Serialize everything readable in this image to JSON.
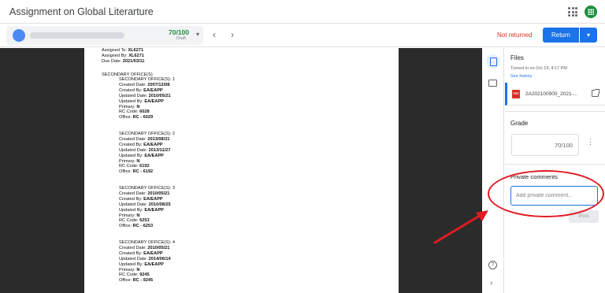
{
  "app": {
    "title": "Assignment on Global Literarture",
    "apps_icon": "apps-grid-icon",
    "logo_icon": "classroom-logo-icon"
  },
  "toolbar": {
    "student_grade": "70/100",
    "student_state": "Draft",
    "caret": "▾",
    "prev": "‹",
    "next": "›",
    "status": "Not returned",
    "return_label": "Return",
    "return_caret": "▾"
  },
  "document": {
    "header": [
      {
        "label": "Assigned To: ",
        "value": "XL6271"
      },
      {
        "label": "Assigned By: ",
        "value": "XL6271"
      },
      {
        "label": "Due Date: ",
        "value": "2021/03/11"
      }
    ],
    "section_title": "SECONDARY OFFICE(S)",
    "offices": [
      {
        "title": "SECONDARY OFFICE(S): 1",
        "created_date": "2007/12/08",
        "created_by": "EA/EAPP",
        "updated_date": "2010/05/21",
        "updated_by": "EA/EAPP",
        "primary": "N",
        "rc_code": "6028",
        "office": "RC - 6029"
      },
      {
        "title": "SECONDARY OFFICE(S): 2",
        "created_date": "2013/08/31",
        "created_by": "EA/EAPP",
        "updated_date": "2013/11/27",
        "updated_by": "EA/EAPP",
        "primary": "N",
        "rc_code": "6192",
        "office": "RC - 6192"
      },
      {
        "title": "SECONDARY OFFICE(S): 3",
        "created_date": "2010/05/21",
        "created_by": "EA/EAPP",
        "updated_date": "2010/08/25",
        "updated_by": "EA/EAPP",
        "primary": "N",
        "rc_code": "6253",
        "office": "RC - 6253"
      },
      {
        "title": "SECONDARY OFFICE(S): 4",
        "created_date": "2010/05/21",
        "created_by": "EA/EAPP",
        "updated_date": "2014/06/14",
        "updated_by": "EA/EAPP",
        "primary": "N",
        "rc_code": "9245",
        "office": "RC - 9245"
      }
    ],
    "labels": {
      "created_date": "Created Date: ",
      "created_by": "Created By: ",
      "updated_date": "Updated Date: ",
      "updated_by": "Updated By: ",
      "primary": "Primary: ",
      "rc_code": "RC Code: ",
      "office": "Office: "
    }
  },
  "panel": {
    "files_heading": "Files",
    "turned_in": "Turned in on Oct 19, 4:17 PM",
    "see_history": "See history",
    "file_name": "2A202100900_2021-...",
    "file_type": "PDF",
    "grade_heading": "Grade",
    "grade_value": "70/100",
    "grade_menu": "⋮",
    "private_comments_heading": "Private comments",
    "private_comment_placeholder": "Add private comment...",
    "post_label": "Post"
  },
  "rail": {
    "help": "?",
    "expand": "›"
  },
  "colors": {
    "accent": "#1a73e8",
    "status_red": "#d93025",
    "grade_green": "#1e8e3e",
    "annotation_red": "#e01b24"
  }
}
